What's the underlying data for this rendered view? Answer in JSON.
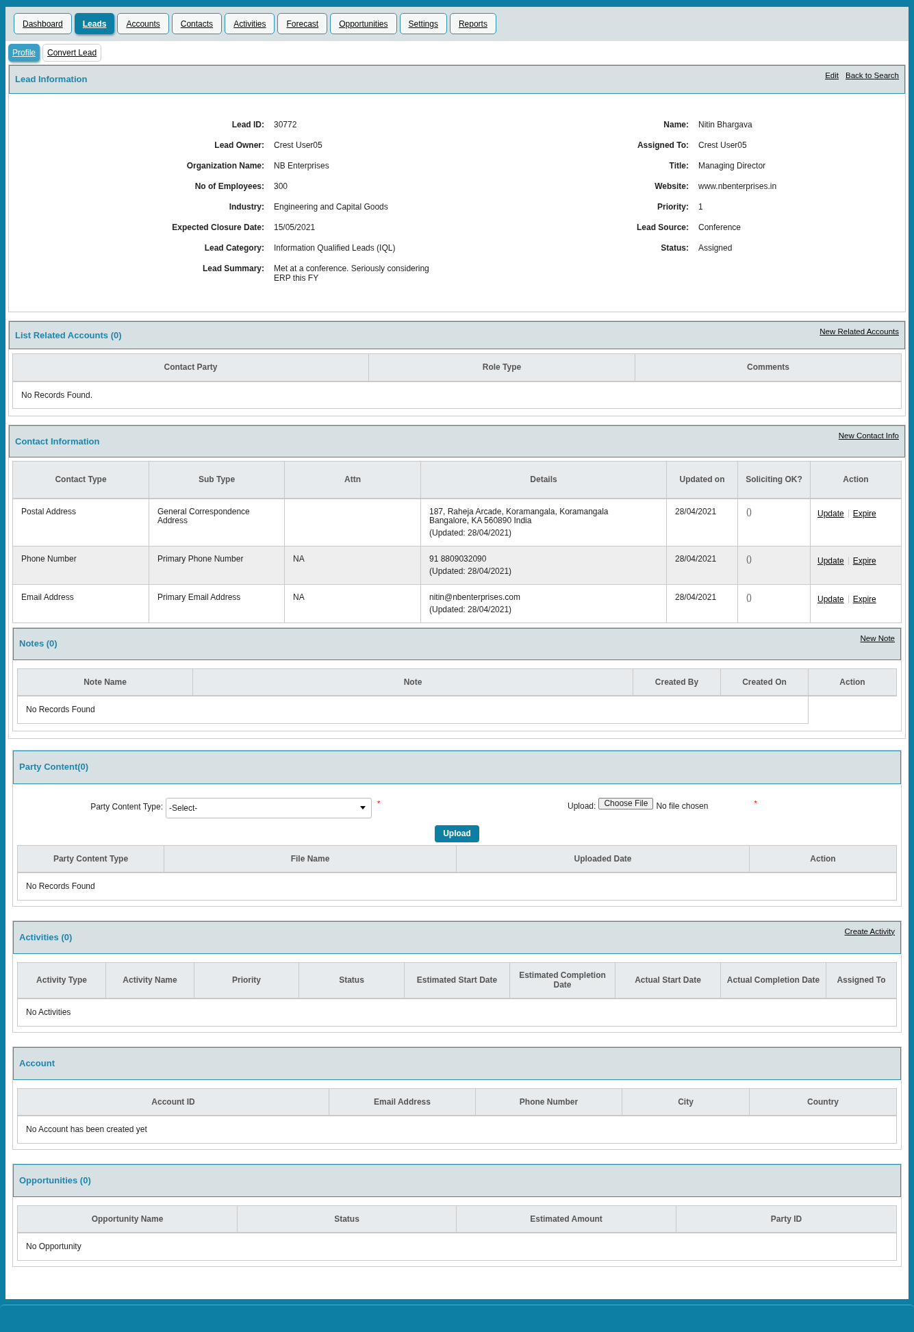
{
  "nav_tabs": [
    {
      "label": "Dashboard",
      "selected": false
    },
    {
      "label": "Leads",
      "selected": true
    },
    {
      "label": "Accounts",
      "selected": false
    },
    {
      "label": "Contacts",
      "selected": false
    },
    {
      "label": "Activities",
      "selected": false
    },
    {
      "label": "Forecast",
      "selected": false
    },
    {
      "label": "Opportunities",
      "selected": false
    },
    {
      "label": "Settings",
      "selected": false
    },
    {
      "label": "Reports",
      "selected": false
    }
  ],
  "sub_tabs": [
    {
      "label": "Profile",
      "selected": true
    },
    {
      "label": "Convert Lead",
      "selected": false
    }
  ],
  "lead_information": {
    "title": "Lead Information",
    "links": [
      "Edit",
      "Back to Search"
    ],
    "left_fields": [
      {
        "label": "Lead ID:",
        "value": "30772"
      },
      {
        "label": "Lead Owner:",
        "value": "Crest User05"
      },
      {
        "label": "Organization Name:",
        "value": "NB Enterprises"
      },
      {
        "label": "No of Employees:",
        "value": "300"
      },
      {
        "label": "Industry:",
        "value": "Engineering and Capital Goods"
      },
      {
        "label": "Expected Closure Date:",
        "value": "15/05/2021"
      },
      {
        "label": "Lead Category:",
        "value": "Information Qualified Leads (IQL)"
      },
      {
        "label": "Lead Summary:",
        "value": "Met at a conference. Seriously considering ERP this FY"
      }
    ],
    "right_fields": [
      {
        "label": "Name:",
        "value": "Nitin Bhargava"
      },
      {
        "label": "Assigned To:",
        "value": "Crest User05"
      },
      {
        "label": "Title:",
        "value": "Managing Director"
      },
      {
        "label": "Website:",
        "value": "www.nbenterprises.in"
      },
      {
        "label": "Priority:",
        "value": "1"
      },
      {
        "label": "Lead Source:",
        "value": "Conference"
      },
      {
        "label": "Status:",
        "value": "Assigned"
      }
    ]
  },
  "related_accounts": {
    "title": "List Related Accounts (0)",
    "links": [
      "New Related Accounts"
    ],
    "columns": [
      "Contact Party",
      "Role Type",
      "Comments"
    ],
    "empty_message": "No Records Found."
  },
  "contact_information": {
    "title": "Contact Information",
    "links": [
      "New Contact Info"
    ],
    "columns": [
      "Contact Type",
      "Sub Type",
      "Attn",
      "Details",
      "Updated on",
      "Soliciting OK?",
      "Action"
    ],
    "rows": [
      {
        "contact_type": "Postal Address",
        "sub_type": "General Correspondence Address",
        "attn": "",
        "details": [
          "187, Raheja Arcade, Koramangala, Koramangala Bangalore, KA 560890 India",
          "(Updated: 28/04/2021)"
        ],
        "updated_on": "28/04/2021",
        "soliciting": "()",
        "actions": [
          "Update",
          "Expire"
        ]
      },
      {
        "contact_type": "Phone Number",
        "sub_type": "Primary Phone Number",
        "attn": "NA",
        "details": [
          "91 8809032090",
          "(Updated: 28/04/2021)"
        ],
        "updated_on": "28/04/2021",
        "soliciting": "()",
        "actions": [
          "Update",
          "Expire"
        ]
      },
      {
        "contact_type": "Email Address",
        "sub_type": "Primary Email Address",
        "attn": "NA",
        "details": [
          "nitin@nbenterprises.com",
          "(Updated: 28/04/2021)"
        ],
        "updated_on": "28/04/2021",
        "soliciting": "()",
        "actions": [
          "Update",
          "Expire"
        ]
      }
    ]
  },
  "notes": {
    "title": "Notes (0)",
    "links": [
      "New Note"
    ],
    "columns": [
      "Note Name",
      "Note",
      "Created By",
      "Created On",
      "Action"
    ],
    "empty_message": "No Records Found"
  },
  "party_content": {
    "title": "Party Content(0)",
    "type_label": "Party Content Type:",
    "select_value": "-Select-",
    "type_required": "*",
    "upload_label": "Upload:",
    "file_button": "Choose File",
    "file_status": "No file chosen",
    "upload_required": "*",
    "upload_button": "Upload",
    "columns": [
      "Party Content Type",
      "File Name",
      "Uploaded Date",
      "Action"
    ],
    "empty_message": "No Records Found"
  },
  "activities": {
    "title": "Activities (0)",
    "links": [
      "Create Activity"
    ],
    "columns": [
      "Activity Type",
      "Activity Name",
      "Priority",
      "Status",
      "Estimated Start Date",
      "Estimated Completion Date",
      "Actual Start Date",
      "Actual Completion Date",
      "Assigned To"
    ],
    "empty_message": "No Activities"
  },
  "account": {
    "title": "Account",
    "columns": [
      "Account ID",
      "Email Address",
      "Phone Number",
      "City",
      "Country"
    ],
    "empty_message": "No Account has been created yet"
  },
  "opportunities": {
    "title": "Opportunities (0)",
    "columns": [
      "Opportunity Name",
      "Status",
      "Estimated Amount",
      "Party ID"
    ],
    "empty_message": "No Opportunity"
  }
}
